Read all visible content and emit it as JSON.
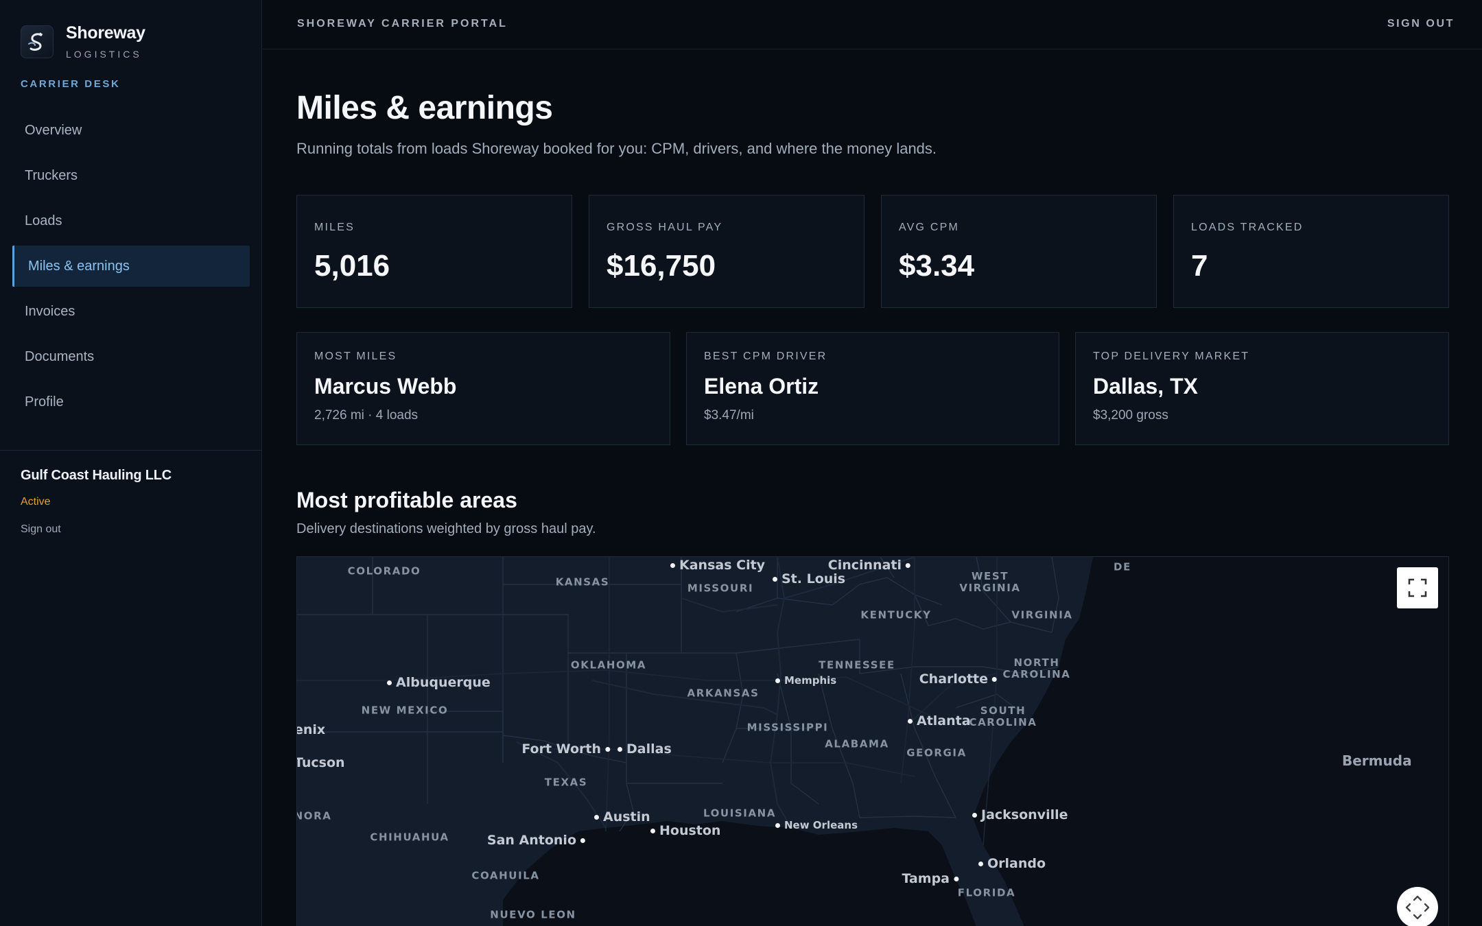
{
  "brand": {
    "name": "Shoreway",
    "sub": "LOGISTICS",
    "desk_label": "CARRIER DESK"
  },
  "sidebar": {
    "items": [
      {
        "label": "Overview"
      },
      {
        "label": "Truckers"
      },
      {
        "label": "Loads"
      },
      {
        "label": "Miles & earnings",
        "active": true
      },
      {
        "label": "Invoices"
      },
      {
        "label": "Documents"
      },
      {
        "label": "Profile"
      }
    ],
    "account": {
      "name": "Gulf Coast Hauling LLC",
      "status": "Active",
      "signout": "Sign out"
    }
  },
  "topbar": {
    "title": "SHOREWAY CARRIER PORTAL",
    "signout": "SIGN OUT"
  },
  "page": {
    "title": "Miles & earnings",
    "subtitle": "Running totals from loads Shoreway booked for you: CPM, drivers, and where the money lands."
  },
  "stats": [
    {
      "label": "MILES",
      "value": "5,016"
    },
    {
      "label": "GROSS HAUL PAY",
      "value": "$16,750"
    },
    {
      "label": "AVG CPM",
      "value": "$3.34"
    },
    {
      "label": "LOADS TRACKED",
      "value": "7"
    }
  ],
  "highlights": [
    {
      "label": "MOST MILES",
      "value": "Marcus Webb",
      "detail": "2,726 mi · 4 loads"
    },
    {
      "label": "BEST CPM DRIVER",
      "value": "Elena Ortiz",
      "detail": "$3.47/mi"
    },
    {
      "label": "TOP DELIVERY MARKET",
      "value": "Dallas, TX",
      "detail": "$3,200 gross"
    }
  ],
  "section": {
    "title": "Most profitable areas",
    "subtitle": "Delivery destinations weighted by gross haul pay."
  },
  "map": {
    "regions": {
      "colorado": "COLORADO",
      "kansas": "KANSAS",
      "missouri": "MISSOURI",
      "de": "DE",
      "west_virginia_1": "WEST",
      "west_virginia_2": "VIRGINIA",
      "kentucky": "KENTUCKY",
      "virginia": "VIRGINIA",
      "oklahoma": "OKLAHOMA",
      "tennessee": "TENNESSEE",
      "north_carolina_1": "NORTH",
      "north_carolina_2": "CAROLINA",
      "arkansas": "ARKANSAS",
      "new_mexico": "NEW MEXICO",
      "south_carolina_1": "SOUTH",
      "south_carolina_2": "CAROLINA",
      "mississippi": "MISSISSIPPI",
      "alabama": "ALABAMA",
      "georgia": "GEORGIA",
      "texas": "TEXAS",
      "sonora": "NORA",
      "louisiana": "LOUISIANA",
      "chihuahua": "CHIHUAHUA",
      "coahuila": "COAHUILA",
      "florida": "FLORIDA",
      "nuevo_leon": "NUEVO LEON"
    },
    "cities": {
      "kansas_city": "Kansas City",
      "st_louis": "St. Louis",
      "cincinnati": "Cincinnati",
      "albuquerque": "Albuquerque",
      "memphis": "Memphis",
      "charlotte": "Charlotte",
      "phoenix": "enix",
      "atlanta": "Atlanta",
      "tucson": "Tucson",
      "fort_worth": "Fort Worth",
      "dallas": "Dallas",
      "austin": "Austin",
      "jacksonville": "Jacksonville",
      "houston": "Houston",
      "new_orleans": "New Orleans",
      "san_antonio": "San Antonio",
      "orlando": "Orlando",
      "tampa": "Tampa"
    },
    "ocean": {
      "bermuda": "Bermuda"
    },
    "controls": {
      "fullscreen_icon": "fullscreen-icon",
      "move_icon": "move-arrows-icon"
    },
    "colors": {
      "land": "#141d2c",
      "water": "#0a0f18"
    }
  },
  "colors": {
    "accent": "#5aa2dc",
    "active_bg": "#13253a",
    "status_active": "#e0a03a",
    "background": "#070b12"
  }
}
